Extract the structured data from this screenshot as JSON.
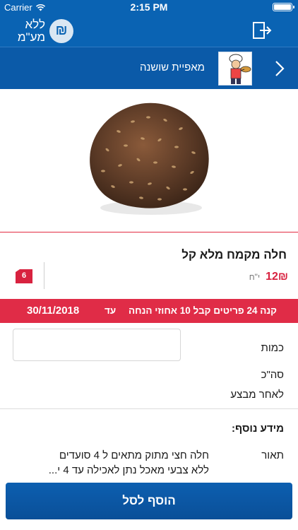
{
  "status_bar": {
    "carrier": "Carrier",
    "time": "2:15 PM"
  },
  "header": {
    "vat_toggle_text": "ללא מע\"מ",
    "shekel_symbol": "₪"
  },
  "store": {
    "name": "מאפיית שושנה"
  },
  "product": {
    "title": "חלה מקמח מלא קל",
    "price": "12₪",
    "unit": "י\"ח",
    "cart_count": "6"
  },
  "promo": {
    "text": "קנה 24 פריטים קבל 10 אחוזי הנחה",
    "until_label": "עד",
    "date": "30/11/2018"
  },
  "form": {
    "quantity_label": "כמות",
    "quantity_value": "",
    "quantity_placeholder": "",
    "total_label": "סה\"כ",
    "after_discount_label": "לאחר מבצע"
  },
  "more_info": {
    "title": "מידע נוסף:",
    "description_label": "תאור",
    "description_line1": "חלה חצי מתוק מתאים ל 4 סועדים",
    "description_line2": "ללא צבעי מאכל נתן לאכילה עד 4 י..."
  },
  "actions": {
    "add_to_cart": "הוסף לסל"
  },
  "colors": {
    "brand_blue": "#0a63b3",
    "accent_red": "#e02c47",
    "price_red": "#d8223f"
  }
}
